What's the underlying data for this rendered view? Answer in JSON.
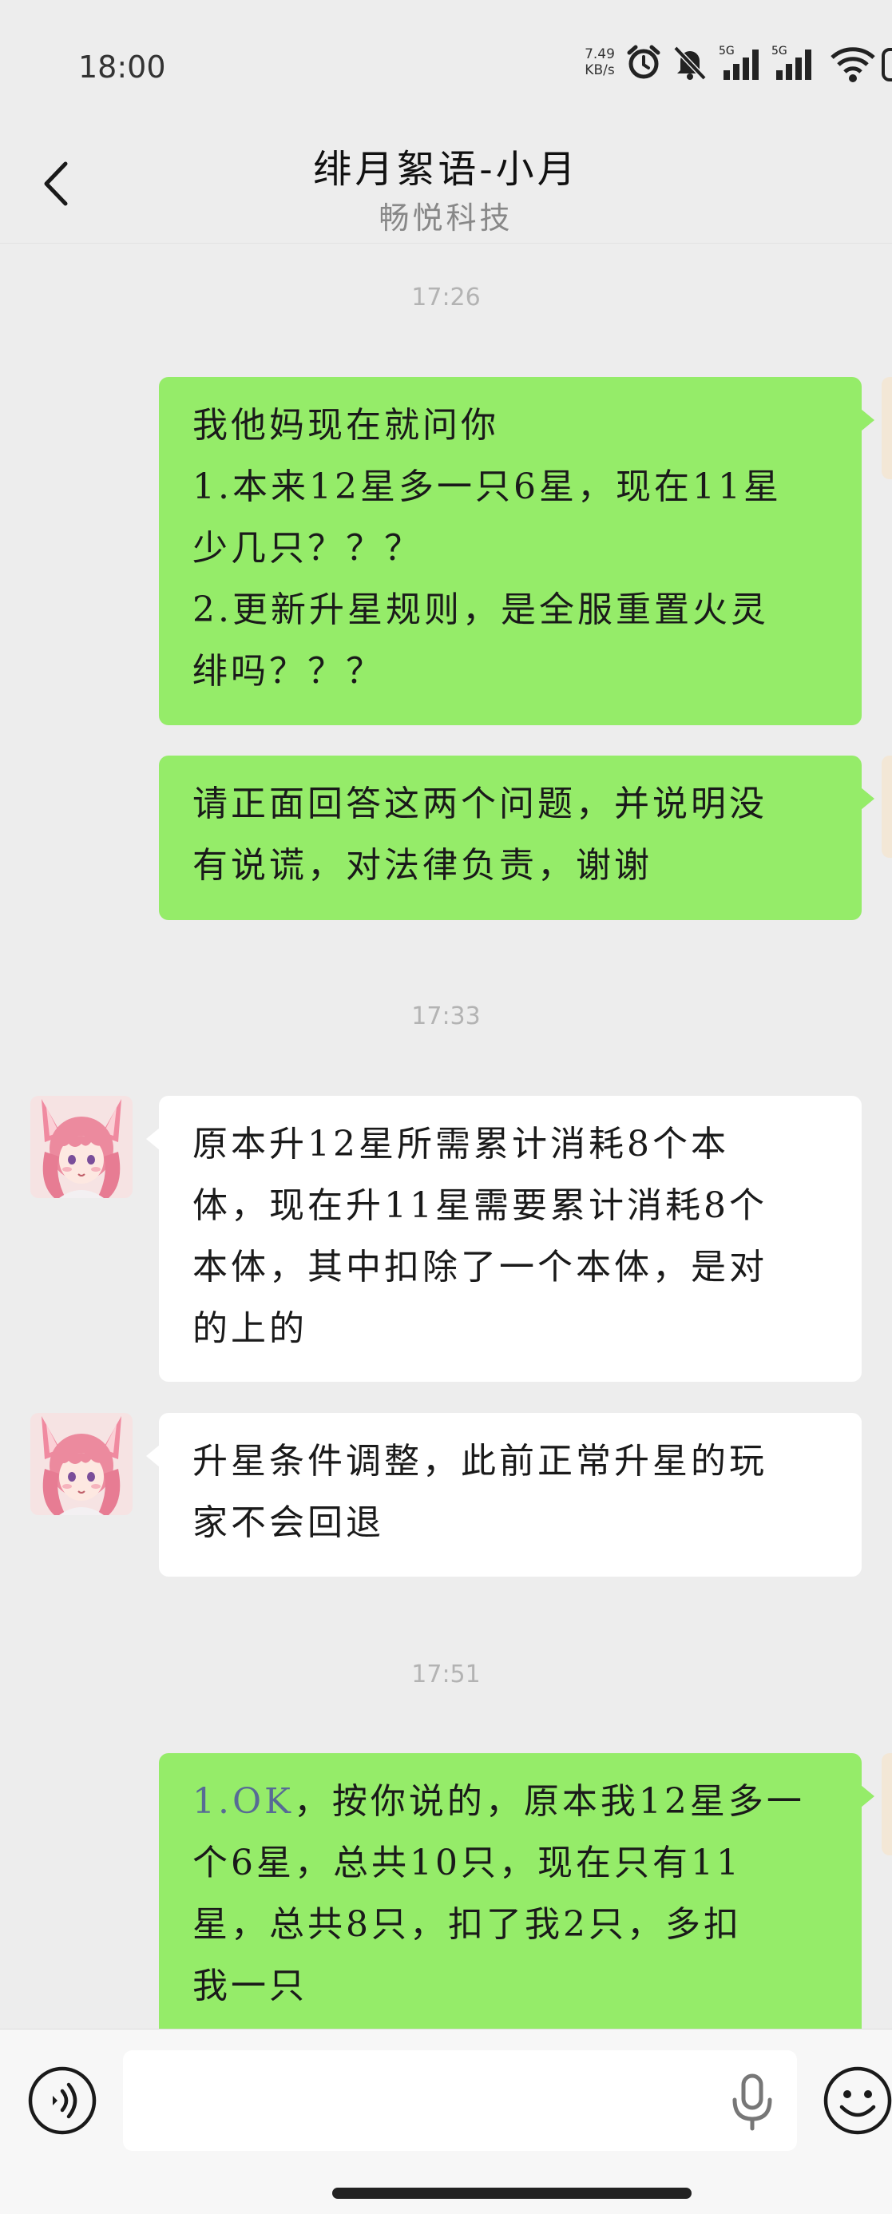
{
  "status_bar": {
    "time": "18:00",
    "net_speed_value": "7.49",
    "net_speed_unit": "KB/s",
    "signal_1_label": "5G",
    "signal_2_label": "5G",
    "icons": [
      "alarm-icon",
      "bell-off-icon",
      "signal-5g-icon",
      "signal-5g-icon",
      "wifi-icon",
      "battery-icon"
    ]
  },
  "header": {
    "title": "绯月絮语-小月",
    "subtitle": "畅悦科技"
  },
  "timestamps": [
    "17:26",
    "17:33",
    "17:51"
  ],
  "messages": [
    {
      "sender": "me",
      "lines": [
        "我他妈现在就问你",
        "1.本来12星多一只6星，现在11星",
        "少几只？？？",
        "2.更新升星规则，是全服重置火灵",
        "绯吗？？？"
      ]
    },
    {
      "sender": "me",
      "lines": [
        "请正面回答这两个问题，并说明没",
        "有说谎，对法律负责，谢谢"
      ]
    },
    {
      "sender": "them",
      "lines": [
        "原本升12星所需累计消耗8个本",
        "体，现在升11星需要累计消耗8个",
        "本体，其中扣除了一个本体，是对",
        "的上的"
      ]
    },
    {
      "sender": "them",
      "lines": [
        "升星条件调整，此前正常升星的玩",
        "家不会回退"
      ]
    },
    {
      "sender": "me",
      "link_text": "1.OK",
      "first_line_rest": "，按你说的，原本我12星多一",
      "lines": [
        "个6星，总共10只，现在只有11",
        "星，总共8只，扣了我2只，多扣",
        "我一只"
      ]
    }
  ],
  "input_bar": {
    "placeholder": ""
  },
  "colors": {
    "my_bubble": "#95ec69",
    "their_bubble": "#ffffff",
    "background": "#ededed",
    "link": "#576b95"
  }
}
